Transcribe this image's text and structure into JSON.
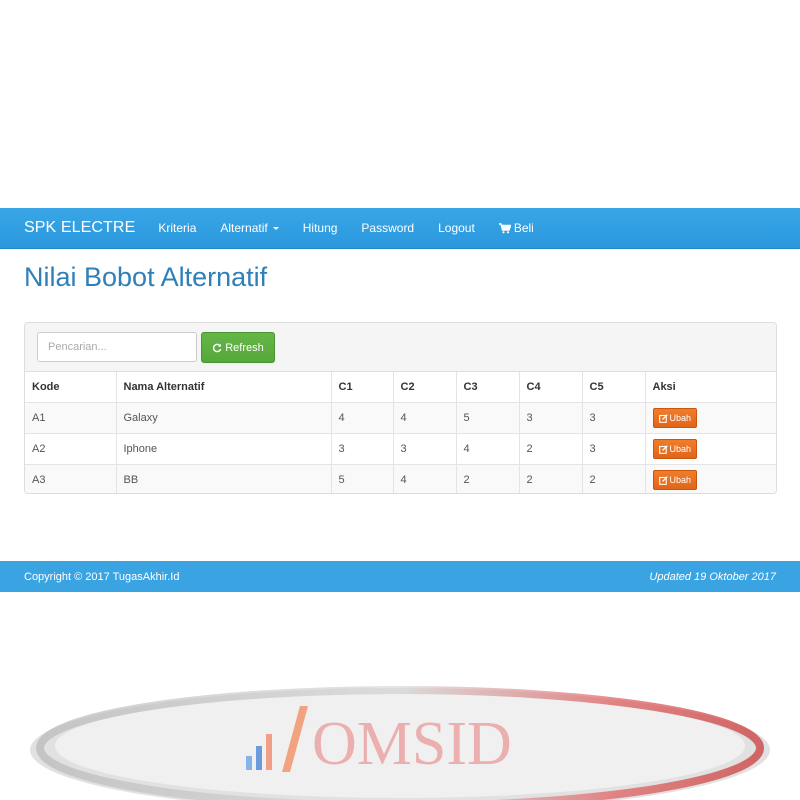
{
  "navbar": {
    "brand": "SPK ELECTRE",
    "items": [
      {
        "label": "Kriteria"
      },
      {
        "label": "Alternatif"
      },
      {
        "label": "Hitung"
      },
      {
        "label": "Password"
      },
      {
        "label": "Logout"
      },
      {
        "label": "Beli"
      }
    ]
  },
  "page": {
    "title": "Nilai Bobot Alternatif"
  },
  "toolbar": {
    "search_placeholder": "Pencarian...",
    "search_value": "",
    "refresh_label": "Refresh"
  },
  "table": {
    "headers": [
      "Kode",
      "Nama Alternatif",
      "C1",
      "C2",
      "C3",
      "C4",
      "C5",
      "Aksi"
    ],
    "rows": [
      {
        "kode": "A1",
        "nama": "Galaxy",
        "c1": "4",
        "c2": "4",
        "c3": "5",
        "c4": "3",
        "c5": "3",
        "aksi": "Ubah"
      },
      {
        "kode": "A2",
        "nama": "Iphone",
        "c1": "3",
        "c2": "3",
        "c3": "4",
        "c4": "2",
        "c5": "3",
        "aksi": "Ubah"
      },
      {
        "kode": "A3",
        "nama": "BB",
        "c1": "5",
        "c2": "4",
        "c3": "2",
        "c4": "2",
        "c5": "2",
        "aksi": "Ubah"
      }
    ]
  },
  "footer": {
    "copyright": "Copyright © 2017 TugasAkhir.Id",
    "updated": "Updated 19 Oktober 2017"
  },
  "watermark": {
    "text": "OMSID"
  },
  "colors": {
    "navbar": "#3aa6e6",
    "title": "#2f7fb8",
    "refresh": "#5cb040",
    "ubah": "#e8711f",
    "footer": "#3aa3e2"
  }
}
